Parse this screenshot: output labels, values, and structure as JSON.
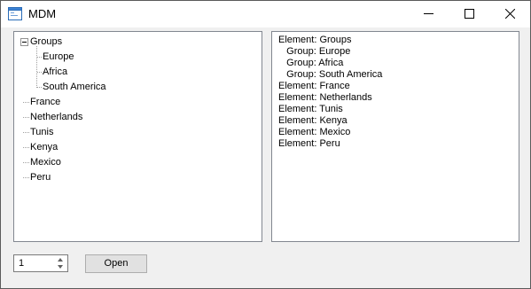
{
  "window": {
    "title": "MDM",
    "app_icon": "window-app-icon",
    "controls": [
      "minimize-icon",
      "maximize-icon",
      "close-icon"
    ]
  },
  "tree": {
    "root": {
      "label": "Groups",
      "expanded": true,
      "children": [
        {
          "label": "Europe"
        },
        {
          "label": "Africa"
        },
        {
          "label": "South America"
        }
      ]
    },
    "items": [
      {
        "label": "France"
      },
      {
        "label": "Netherlands"
      },
      {
        "label": "Tunis"
      },
      {
        "label": "Kenya"
      },
      {
        "label": "Mexico"
      },
      {
        "label": "Peru"
      }
    ]
  },
  "output": {
    "lines": [
      "Element: Groups",
      "   Group: Europe",
      "   Group: Africa",
      "   Group: South America",
      "Element: France",
      "Element: Netherlands",
      "Element: Tunis",
      "Element: Kenya",
      "Element: Mexico",
      "Element: Peru"
    ]
  },
  "controls": {
    "spinner_value": "1",
    "open_label": "Open"
  }
}
